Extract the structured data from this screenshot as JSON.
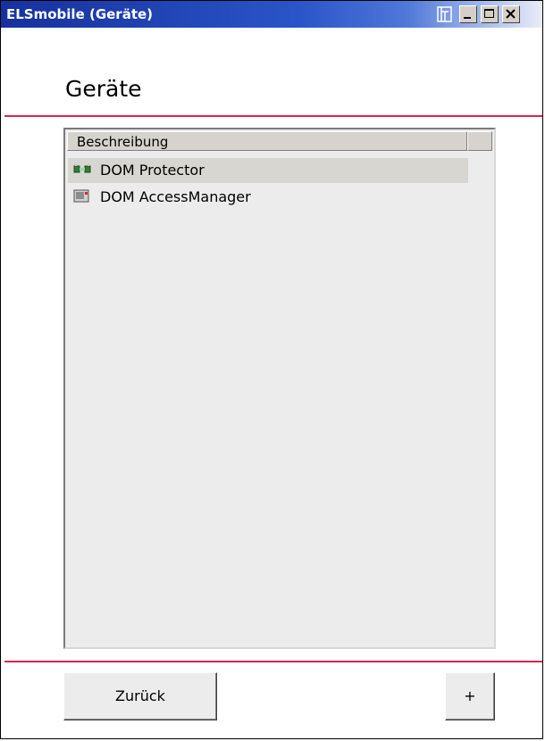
{
  "window": {
    "title": "ELSmobile (Geräte)",
    "controls": {
      "pin_icon": "pin-icon",
      "minimize_icon": "minimize-icon",
      "maximize_icon": "maximize-icon",
      "close_icon": "close-icon"
    }
  },
  "page": {
    "heading": "Geräte",
    "accent_color": "#d8264f"
  },
  "device_list": {
    "column_header": "Beschreibung",
    "items": [
      {
        "label": "DOM Protector",
        "icon": "protector-device-icon",
        "selected": true
      },
      {
        "label": "DOM AccessManager",
        "icon": "access-manager-device-icon",
        "selected": false
      }
    ]
  },
  "footer": {
    "back_label": "Zurück",
    "add_label": "+"
  }
}
